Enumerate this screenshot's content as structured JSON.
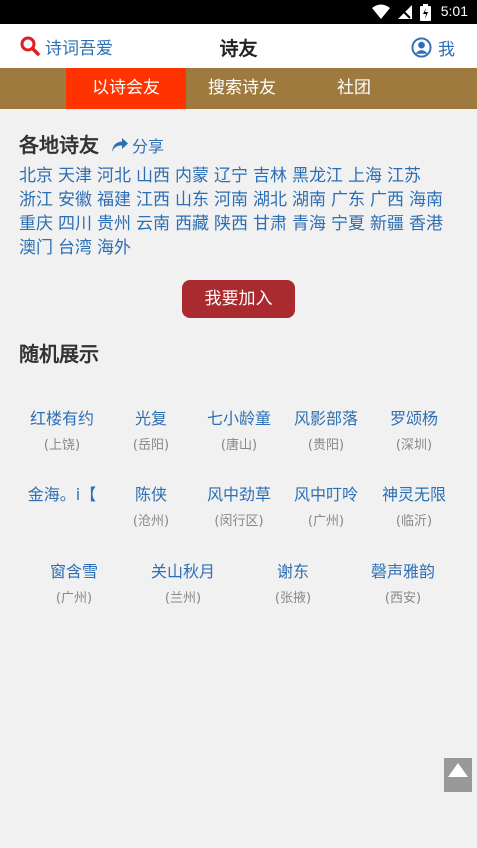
{
  "status": {
    "time": "5:01"
  },
  "header": {
    "search_label": "诗词吾爱",
    "title": "诗友",
    "me_label": "我"
  },
  "tabs": [
    {
      "label": "以诗会友",
      "active": true
    },
    {
      "label": "搜索诗友",
      "active": false
    },
    {
      "label": "社团",
      "active": false
    }
  ],
  "regions_section": {
    "title": "各地诗友",
    "share_label": "分享",
    "regions": [
      "北京",
      "天津",
      "河北",
      "山西",
      "内蒙",
      "辽宁",
      "吉林",
      "黑龙江",
      "上海",
      "江苏",
      "浙江",
      "安徽",
      "福建",
      "江西",
      "山东",
      "河南",
      "湖北",
      "湖南",
      "广东",
      "广西",
      "海南",
      "重庆",
      "四川",
      "贵州",
      "云南",
      "西藏",
      "陕西",
      "甘肃",
      "青海",
      "宁夏",
      "新疆",
      "香港",
      "澳门",
      "台湾",
      "海外"
    ]
  },
  "join_label": "我要加入",
  "random_section": {
    "title": "随机展示",
    "rows": [
      [
        {
          "name": "红楼有约",
          "city": "(上饶)"
        },
        {
          "name": "光复",
          "city": "(岳阳)"
        },
        {
          "name": "七小龄童",
          "city": "(唐山)"
        },
        {
          "name": "风影部落",
          "city": "(贵阳)"
        },
        {
          "name": "罗颂杨",
          "city": "(深圳)"
        }
      ],
      [
        {
          "name": "金海。i【",
          "city": ""
        },
        {
          "name": "陈侠",
          "city": "(沧州)"
        },
        {
          "name": "风中劲草",
          "city": "(闵行区)"
        },
        {
          "name": "风中叮呤",
          "city": "(广州)"
        },
        {
          "name": "神灵无限",
          "city": "(临沂)"
        }
      ],
      [
        {
          "name": "窗含雪",
          "city": "(广州)"
        },
        {
          "name": "关山秋月",
          "city": "(兰州)"
        },
        {
          "name": "谢东",
          "city": "(张掖)"
        },
        {
          "name": "磬声雅韵",
          "city": "(西安)"
        }
      ]
    ]
  },
  "colors": {
    "accent_blue": "#2d6fb4",
    "tab_bar": "#9f7a3f",
    "tab_active": "#ff3300",
    "join_button": "#a92a2f"
  },
  "icons": {
    "search": "search-icon",
    "user": "user-icon",
    "share": "share-icon",
    "to_top": "arrow-up-icon"
  }
}
